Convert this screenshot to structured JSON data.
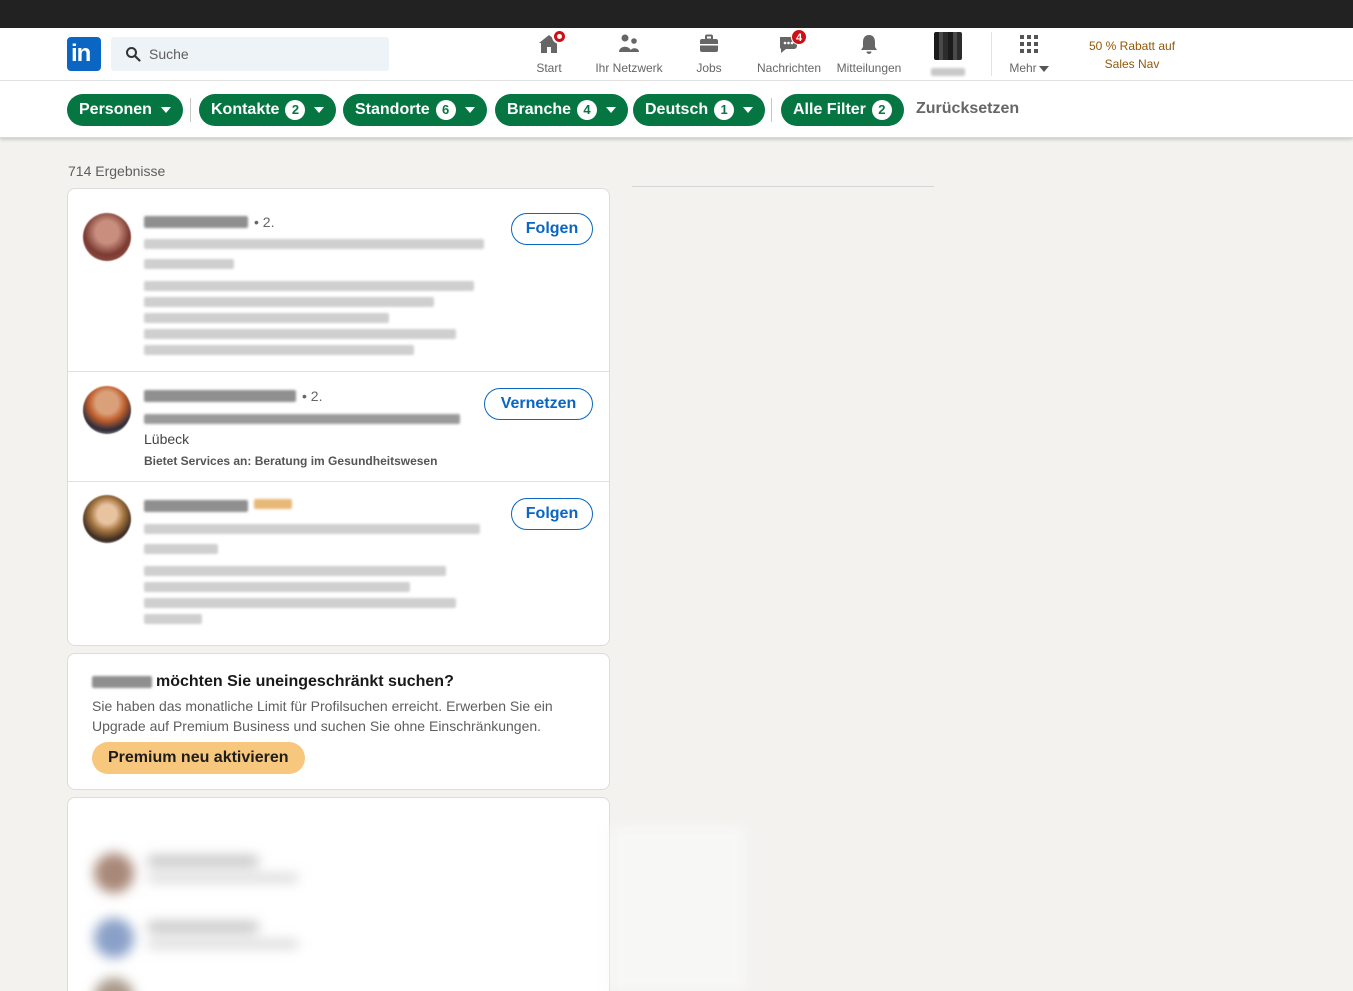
{
  "nav": {
    "search_placeholder": "Suche",
    "items": [
      {
        "label": "Start",
        "icon": "home-icon"
      },
      {
        "label": "Ihr Netzwerk",
        "icon": "network-icon"
      },
      {
        "label": "Jobs",
        "icon": "briefcase-icon"
      },
      {
        "label": "Nachrichten",
        "icon": "messaging-icon",
        "badge": "4"
      },
      {
        "label": "Mitteilungen",
        "icon": "bell-icon"
      },
      {
        "label": "Mehr",
        "icon": "grid-icon"
      }
    ],
    "promo": "50 % Rabatt auf Sales Nav"
  },
  "filters": {
    "pills": [
      {
        "label": "Personen",
        "count": ""
      },
      {
        "label": "Kontakte",
        "count": "2"
      },
      {
        "label": "Standorte",
        "count": "6"
      },
      {
        "label": "Branche",
        "count": "4"
      },
      {
        "label": "Deutsch",
        "count": "1"
      },
      {
        "label": "Alle Filter",
        "count": "2"
      }
    ],
    "reset": "Zurücksetzen"
  },
  "results": {
    "count_label": "714 Ergebnisse",
    "items": [
      {
        "degree": "• 2.",
        "button": "Folgen"
      },
      {
        "degree": "• 2.",
        "location": "Lübeck",
        "services": "Bietet Services an: Beratung im Gesundheitswesen",
        "button": "Vernetzen"
      },
      {
        "button": "Folgen"
      }
    ]
  },
  "premium": {
    "title": "möchten Sie uneingeschränkt suchen?",
    "text": "Sie haben das monatliche Limit für Profilsuchen erreicht. Erwerben Sie ein Upgrade auf Premium Business und suchen Sie ohne Einschränkungen.",
    "button": "Premium neu aktivieren"
  },
  "colors": {
    "linkedin_blue": "#0a66c2",
    "filter_green": "#057642",
    "premium_gold": "#f8c77e",
    "notification_red": "#cc1016",
    "promo_brown": "#915907"
  }
}
